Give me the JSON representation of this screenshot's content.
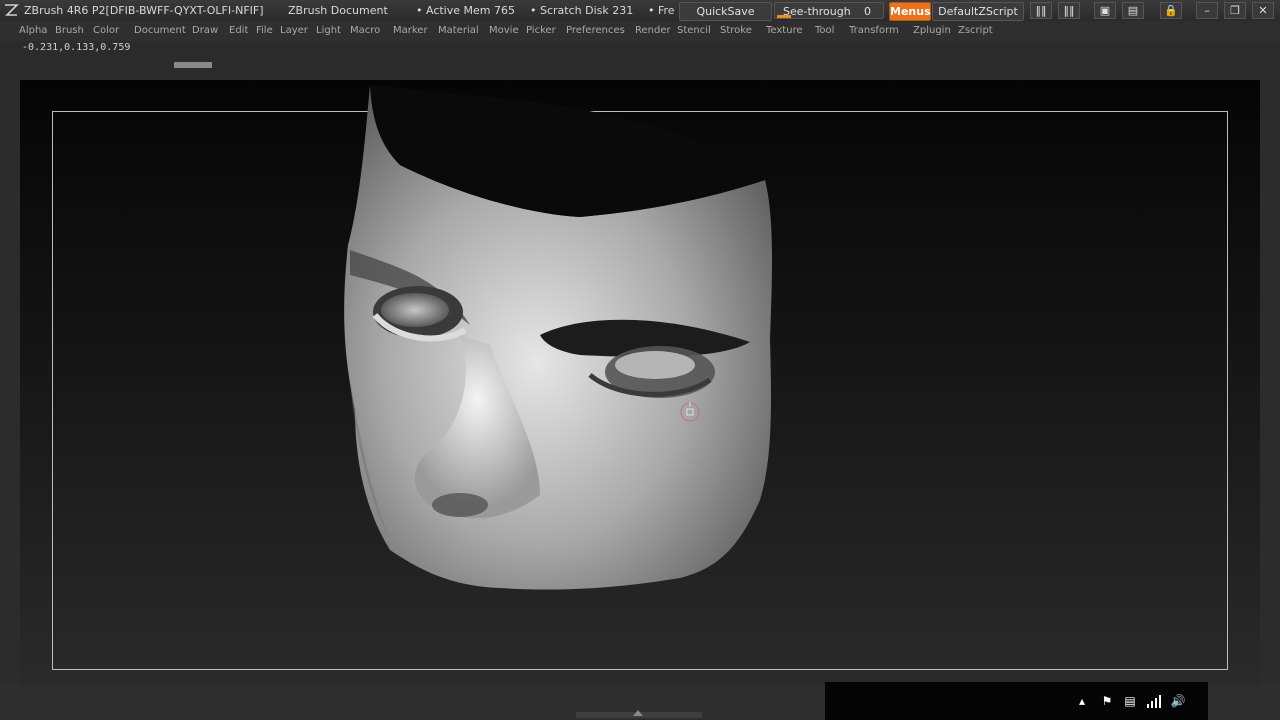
{
  "title_bar": {
    "app_title": "ZBrush 4R6 P2[DFIB-BWFF-QYXT-OLFI-NFIF]",
    "document_title": "ZBrush Document",
    "active_mem": "• Active Mem 765",
    "scratch_disk": "• Scratch Disk 231",
    "free": "• Fre",
    "quicksave_label": "QuickSave",
    "see_through_label": "See-through",
    "see_through_value": "0",
    "menus_label": "Menus",
    "script_label": "DefaultZScript"
  },
  "menu_bar": {
    "items": [
      "Alpha",
      "Brush",
      "Color",
      "Document",
      "Draw",
      "Edit",
      "File",
      "Layer",
      "Light",
      "Macro",
      "Marker",
      "Material",
      "Movie",
      "Picker",
      "Preferences",
      "Render",
      "Stencil",
      "Stroke",
      "Texture",
      "Tool",
      "Transform",
      "Zplugin",
      "Zscript"
    ]
  },
  "coordinates": "-0.231,0.133,0.759",
  "colors": {
    "accent": "#e8731c",
    "title_bg": "#333333",
    "canvas_top": "#050505",
    "canvas_bottom": "#2a2a2a",
    "frame_border": "#bdbdbd"
  },
  "taskbar_icons": [
    "chevron-up-icon",
    "flag-icon",
    "clipboard-icon",
    "signal-icon",
    "volume-icon"
  ]
}
